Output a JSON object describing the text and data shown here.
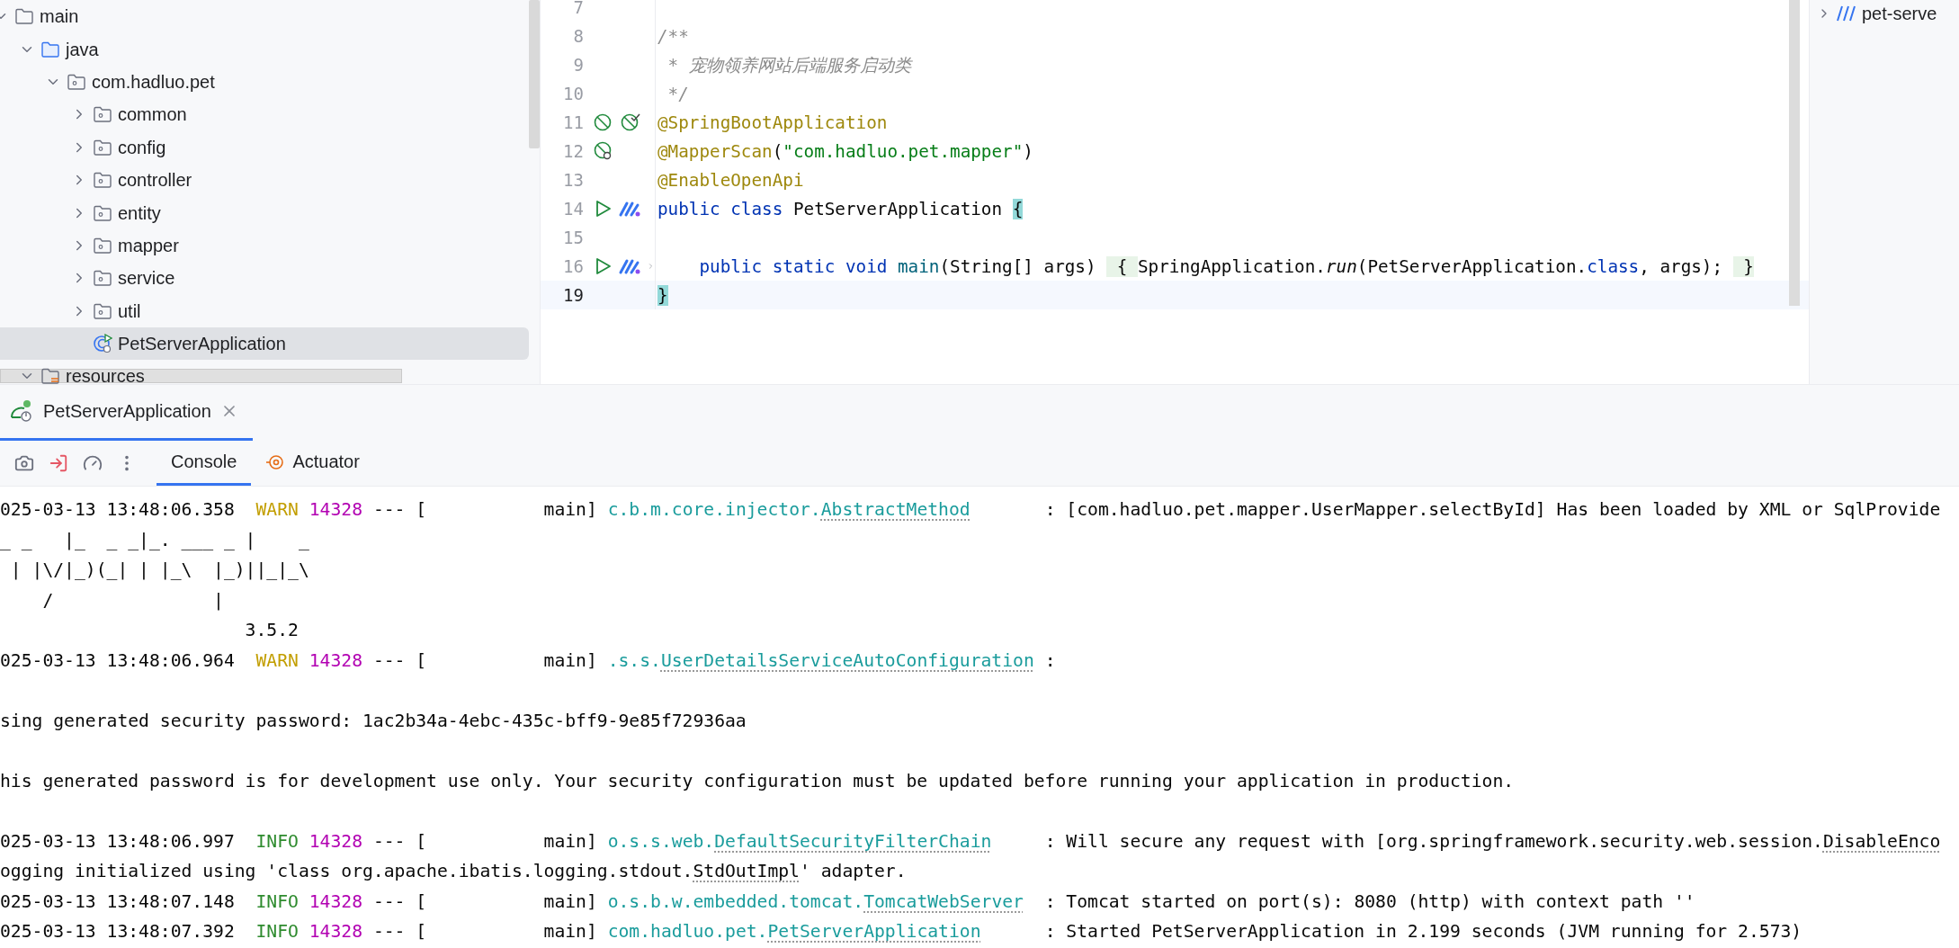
{
  "project_tree": {
    "items": [
      {
        "label": "main",
        "kind": "folder",
        "expanded": true,
        "selected": false,
        "children": [
          {
            "label": "java",
            "kind": "source_root",
            "expanded": true,
            "selected": false,
            "children": [
              {
                "label": "com.hadluo.pet",
                "kind": "package",
                "expanded": true,
                "selected": false,
                "children": [
                  {
                    "label": "common",
                    "kind": "package",
                    "expanded": false,
                    "selected": false
                  },
                  {
                    "label": "config",
                    "kind": "package",
                    "expanded": false,
                    "selected": false
                  },
                  {
                    "label": "controller",
                    "kind": "package",
                    "expanded": false,
                    "selected": false
                  },
                  {
                    "label": "entity",
                    "kind": "package",
                    "expanded": false,
                    "selected": false
                  },
                  {
                    "label": "mapper",
                    "kind": "package",
                    "expanded": false,
                    "selected": false
                  },
                  {
                    "label": "service",
                    "kind": "package",
                    "expanded": false,
                    "selected": false
                  },
                  {
                    "label": "util",
                    "kind": "package",
                    "expanded": false,
                    "selected": false
                  },
                  {
                    "label": "PetServerApplication",
                    "kind": "class",
                    "selected": true
                  }
                ]
              }
            ]
          },
          {
            "label": "resources",
            "kind": "resource_root",
            "expanded": true,
            "selected": false
          }
        ]
      }
    ]
  },
  "editor": {
    "lines": [
      {
        "number": "7",
        "current": false
      },
      {
        "number": "8",
        "current": false,
        "segments": [
          {
            "kind": "comment",
            "text": "/**"
          }
        ]
      },
      {
        "number": "9",
        "current": false,
        "segments": [
          {
            "kind": "comment",
            "text": " * 宠物领养网站后端服务启动类"
          }
        ]
      },
      {
        "number": "10",
        "current": false,
        "segments": [
          {
            "kind": "comment",
            "text": " */"
          }
        ]
      },
      {
        "number": "11",
        "current": false,
        "kind": "beans",
        "segments": [
          {
            "kind": "annotation",
            "text": "@SpringBootApplication"
          }
        ]
      },
      {
        "number": "12",
        "current": false,
        "kind": "scan",
        "segments": [
          {
            "kind": "annotation",
            "text": "@MapperScan"
          },
          {
            "kind": "plain",
            "text": "("
          },
          {
            "kind": "string",
            "text": "\"com.hadluo.pet.mapper\""
          },
          {
            "kind": "plain",
            "text": ")"
          }
        ]
      },
      {
        "number": "13",
        "current": false,
        "segments": [
          {
            "kind": "annotation",
            "text": "@EnableOpenApi"
          }
        ]
      },
      {
        "number": "14",
        "current": false,
        "kind": "run",
        "segments": [
          {
            "kind": "keyword",
            "text": "public class "
          },
          {
            "kind": "plain",
            "text": "PetServerApplication "
          },
          {
            "kind": "brace_match",
            "text": "{"
          }
        ]
      },
      {
        "number": "15",
        "current": false
      },
      {
        "number": "16",
        "current": false,
        "kind": "run_fold",
        "segments": [
          {
            "kind": "keyword",
            "text": "    public static void "
          },
          {
            "kind": "method",
            "text": "main"
          },
          {
            "kind": "plain",
            "text": "(String[] args) "
          },
          {
            "kind": "folded",
            "text": " { "
          },
          {
            "kind": "plain",
            "text": "SpringApplication."
          },
          {
            "kind": "static_call",
            "text": "run"
          },
          {
            "kind": "plain",
            "text": "(PetServerApplication."
          },
          {
            "kind": "keyword",
            "text": "class"
          },
          {
            "kind": "plain",
            "text": ", args); "
          },
          {
            "kind": "folded",
            "text": " }"
          }
        ]
      },
      {
        "number": "19",
        "current": true,
        "segments": [
          {
            "kind": "brace_match",
            "text": "}"
          }
        ]
      }
    ]
  },
  "right_panel": {
    "items": [
      {
        "label": "pet-serve",
        "expanded": false
      }
    ]
  },
  "run_tabs": [
    {
      "label": "PetServerApplication",
      "selected": true
    }
  ],
  "console_tabs": [
    {
      "label": "Console",
      "kind": "console",
      "selected": true
    },
    {
      "label": "Actuator",
      "kind": "actuator",
      "selected": false
    }
  ],
  "console": {
    "lines": [
      {
        "blank_before": false,
        "segments": [
          {
            "kind": "plain",
            "text": "025-03-13 13:48:06.358  "
          },
          {
            "kind": "warn",
            "text": "WARN"
          },
          {
            "kind": "pid",
            "text": " 14328"
          },
          {
            "kind": "plain",
            "text": " --- [           main] "
          },
          {
            "kind": "logger",
            "text": "c.b.m.core.injector."
          },
          {
            "kind": "logger_class",
            "text": "AbstractMethod"
          },
          {
            "kind": "plain",
            "text": "       : [com.hadluo.pet.mapper.UserMapper.selectById] Has been loaded by XML or SqlProvide"
          }
        ]
      },
      {
        "blank_before": false,
        "segments": [
          {
            "kind": "plain",
            "text": "_ _   |_  _ _|_. ___ _ |    _"
          }
        ]
      },
      {
        "blank_before": false,
        "segments": [
          {
            "kind": "plain",
            "text": " | |\\/|_)(_| | |_\\  |_)||_|_\\"
          }
        ]
      },
      {
        "blank_before": false,
        "segments": [
          {
            "kind": "plain",
            "text": "    /               |"
          }
        ]
      },
      {
        "blank_before": false,
        "segments": [
          {
            "kind": "plain",
            "text": "                       3.5.2"
          }
        ]
      },
      {
        "blank_before": false,
        "segments": [
          {
            "kind": "plain",
            "text": "025-03-13 13:48:06.964  "
          },
          {
            "kind": "warn",
            "text": "WARN"
          },
          {
            "kind": "pid",
            "text": " 14328"
          },
          {
            "kind": "plain",
            "text": " --- [           main] "
          },
          {
            "kind": "logger",
            "text": ".s.s."
          },
          {
            "kind": "logger_class",
            "text": "UserDetailsServiceAutoConfiguration"
          },
          {
            "kind": "plain",
            "text": " :"
          }
        ]
      },
      {
        "blank_before": true,
        "segments": [
          {
            "kind": "plain",
            "text": "sing generated security password: 1ac2b34a-4ebc-435c-bff9-9e85f72936aa"
          }
        ]
      },
      {
        "blank_before": true,
        "segments": [
          {
            "kind": "plain",
            "text": "his generated password is for development use only. Your security configuration must be updated before running your application in production."
          }
        ]
      },
      {
        "blank_before": true,
        "segments": [
          {
            "kind": "plain",
            "text": "025-03-13 13:48:06.997  "
          },
          {
            "kind": "info",
            "text": "INFO"
          },
          {
            "kind": "pid",
            "text": " 14328"
          },
          {
            "kind": "plain",
            "text": " --- [           main] "
          },
          {
            "kind": "logger",
            "text": "o.s.s.web."
          },
          {
            "kind": "logger_class",
            "text": "DefaultSecurityFilterChain"
          },
          {
            "kind": "plain",
            "text": "     : Will secure any request with [org.springframework.security.web.session."
          },
          {
            "kind": "underlined",
            "text": "DisableEnco"
          }
        ]
      },
      {
        "blank_before": false,
        "segments": [
          {
            "kind": "plain",
            "text": "ogging initialized using 'class org.apache.ibatis.logging.stdout."
          },
          {
            "kind": "underlined",
            "text": "StdOutImpl"
          },
          {
            "kind": "plain",
            "text": "' adapter."
          }
        ]
      },
      {
        "blank_before": false,
        "segments": [
          {
            "kind": "plain",
            "text": "025-03-13 13:48:07.148  "
          },
          {
            "kind": "info",
            "text": "INFO"
          },
          {
            "kind": "pid",
            "text": " 14328"
          },
          {
            "kind": "plain",
            "text": " --- [           main] "
          },
          {
            "kind": "logger",
            "text": "o.s.b.w.embedded.tomcat."
          },
          {
            "kind": "logger_class",
            "text": "TomcatWebServer"
          },
          {
            "kind": "plain",
            "text": "  : Tomcat started on port(s): 8080 (http) with context path ''"
          }
        ]
      },
      {
        "blank_before": false,
        "segments": [
          {
            "kind": "plain",
            "text": "025-03-13 13:48:07.392  "
          },
          {
            "kind": "info",
            "text": "INFO"
          },
          {
            "kind": "pid",
            "text": " 14328"
          },
          {
            "kind": "plain",
            "text": " --- [           main] "
          },
          {
            "kind": "logger",
            "text": "com.hadluo.pet."
          },
          {
            "kind": "logger_class",
            "text": "PetServerApplication"
          },
          {
            "kind": "plain",
            "text": "      : Started PetServerApplication in 2.199 seconds (JVM running for 2.573)"
          }
        ]
      }
    ]
  }
}
